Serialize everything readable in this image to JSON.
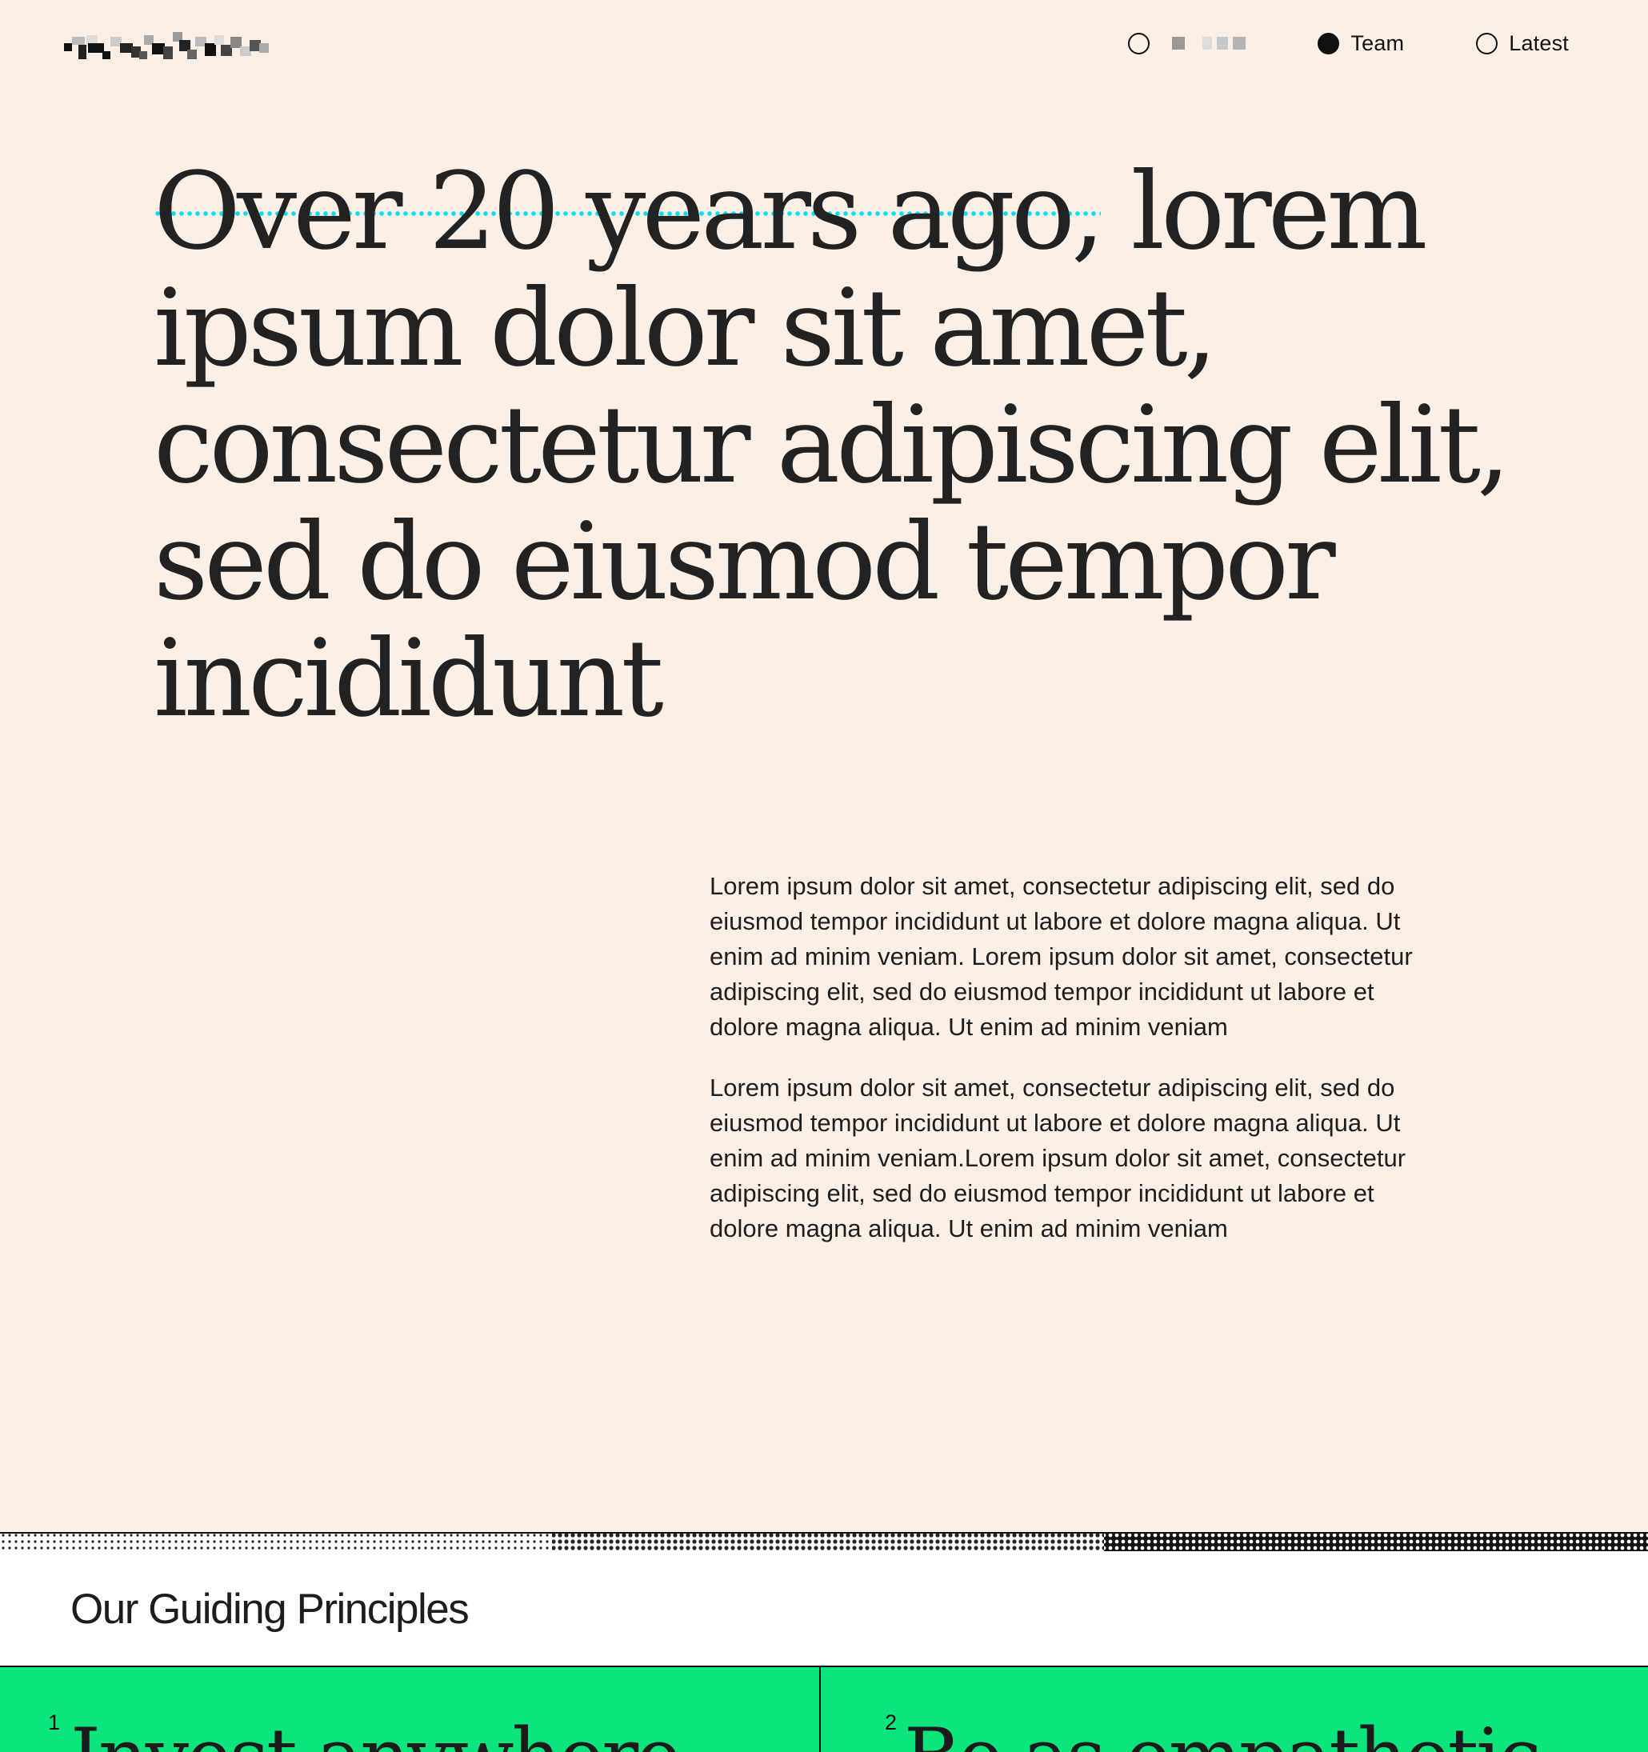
{
  "nav": {
    "items": [
      {
        "label": "",
        "active": false,
        "redacted": true
      },
      {
        "label": "Team",
        "active": true
      },
      {
        "label": "Latest",
        "active": false
      }
    ]
  },
  "hero": {
    "headline_highlight": "Over 20 years ago,",
    "headline_rest": " lorem ipsum dolor sit amet, consectetur adipiscing elit, sed do eiusmod tempor incididunt",
    "highlight_color": "#00e0f5"
  },
  "body": {
    "paragraph_1": "Lorem ipsum dolor sit amet, consectetur adipiscing elit, sed do eiusmod tempor incididunt ut labore et dolore magna aliqua. Ut enim ad minim veniam. Lorem ipsum dolor sit amet, consectetur adipiscing elit, sed do eiusmod tempor incididunt ut labore et dolore magna aliqua. Ut enim ad minim veniam",
    "paragraph_2": "Lorem ipsum dolor sit amet, consectetur adipiscing elit, sed do eiusmod tempor incididunt ut labore et dolore magna aliqua. Ut enim ad minim veniam.Lorem ipsum dolor sit amet, consectetur adipiscing elit, sed do eiusmod tempor incididunt ut labore et dolore magna aliqua. Ut enim ad minim veniam"
  },
  "principles": {
    "title": "Our Guiding Principles",
    "cards": [
      {
        "number": "1",
        "title": "Invest anywhere"
      },
      {
        "number": "2",
        "title": "Be as empathetic"
      }
    ]
  },
  "colors": {
    "background": "#fcefe6",
    "accent_cyan": "#00e0f5",
    "accent_green": "#0ce47e",
    "text": "#222222"
  }
}
